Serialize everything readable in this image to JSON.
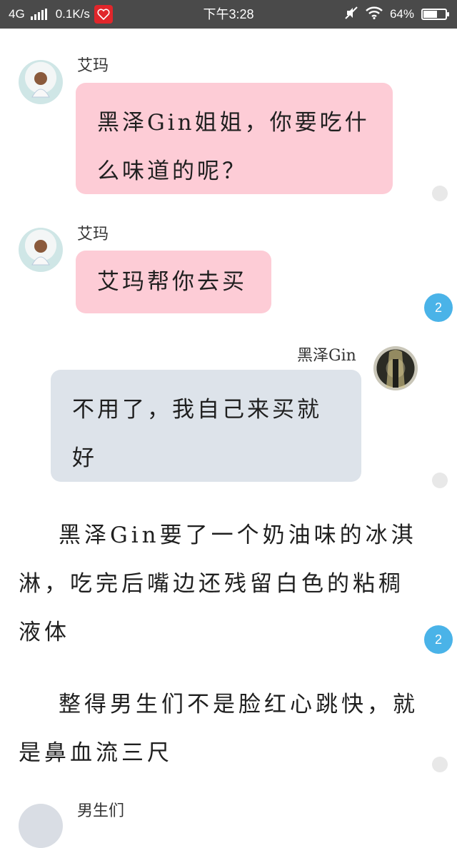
{
  "status_bar": {
    "network": "4G",
    "speed": "0.1K/s",
    "time": "下午3:28",
    "battery": "64%",
    "battery_level": 0.64
  },
  "messages": [
    {
      "speaker": "艾玛",
      "text": "黑泽Gin姐姐，你要吃什么味道的呢？"
    },
    {
      "speaker": "艾玛",
      "text": "艾玛帮你去买"
    },
    {
      "speaker": "黑泽Gin",
      "text": "不用了，我自己来买就好"
    }
  ],
  "narration": [
    "黑泽Gin要了一个奶油味的冰淇淋，吃完后嘴边还残留白色的粘稠液体",
    "整得男生们不是脸红心跳快，就是鼻血流三尺"
  ],
  "next_speaker": "男生们",
  "comment_badges": [
    "2",
    "2"
  ],
  "colors": {
    "pink_bubble": "#fdccd6",
    "gray_bubble": "#dde3ea",
    "badge": "#4ab3e8",
    "status_bar": "#4a4a4a"
  }
}
